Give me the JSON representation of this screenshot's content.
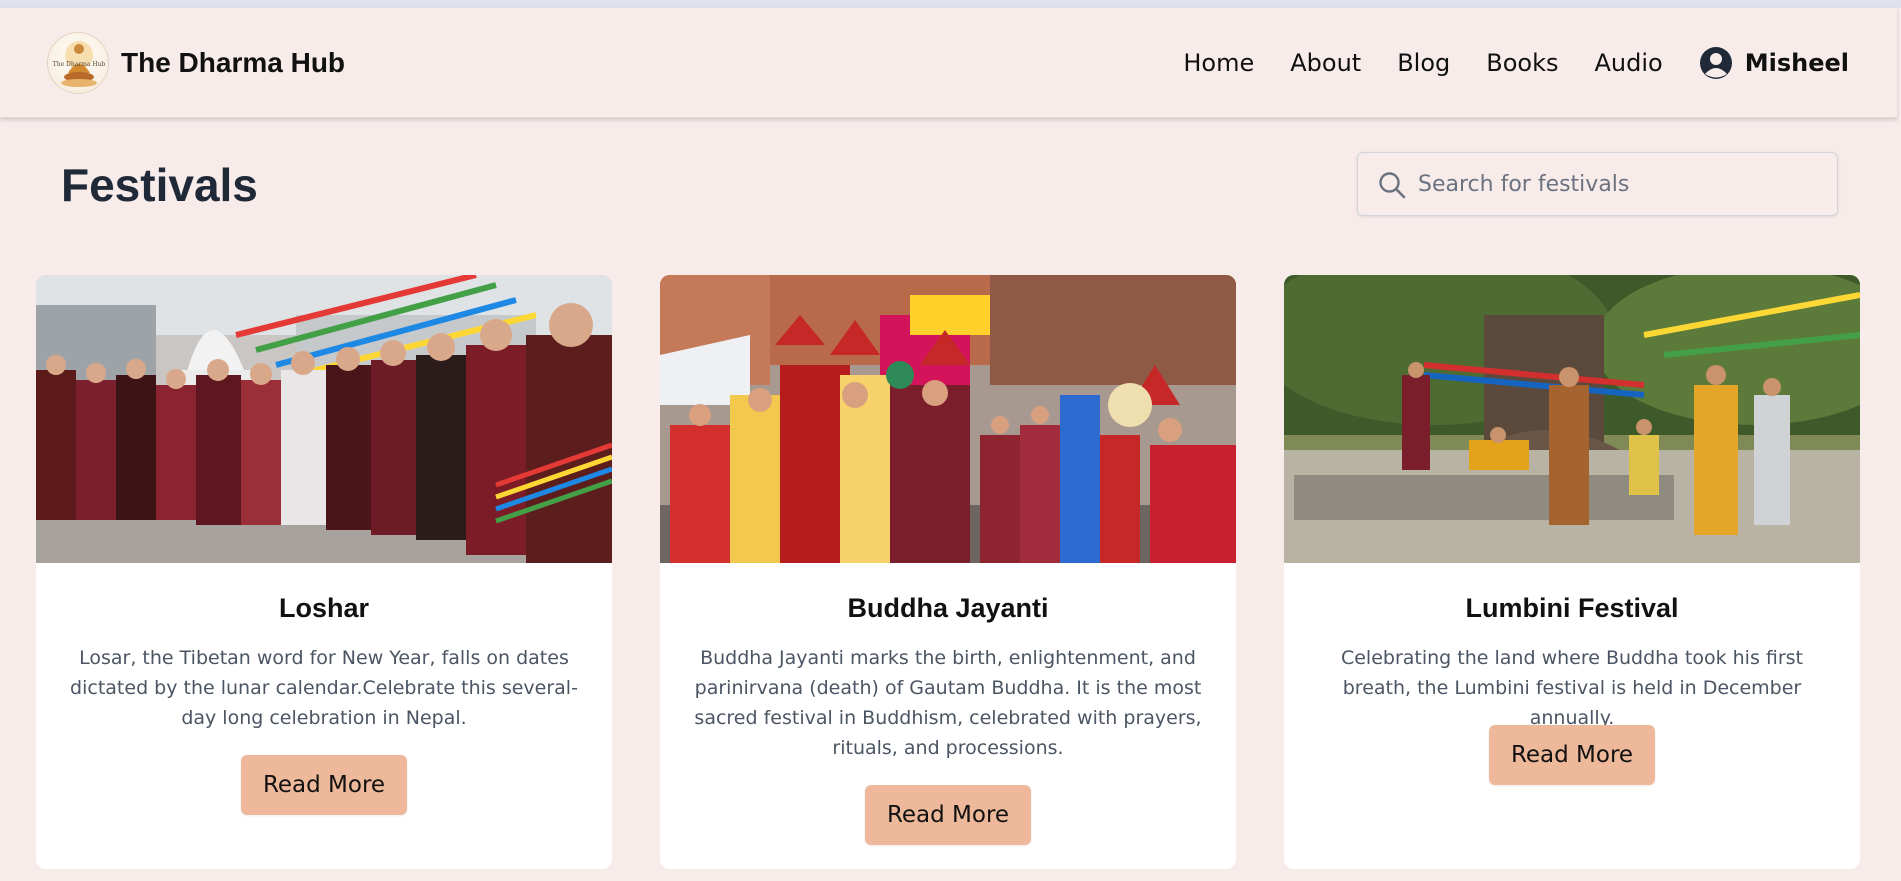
{
  "header": {
    "brand_name": "The Dharma Hub",
    "logo_text": "The Dharma Hub",
    "nav": [
      "Home",
      "About",
      "Blog",
      "Books",
      "Audio"
    ],
    "user_name": "Misheel"
  },
  "page": {
    "title": "Festivals",
    "search_placeholder": "Search for festivals"
  },
  "cards": [
    {
      "title": "Loshar",
      "description": "Losar, the Tibetan word for New Year, falls on dates dictated by the lunar calendar.Celebrate this several-day long celebration in Nepal.",
      "button": "Read More"
    },
    {
      "title": "Buddha Jayanti",
      "description": "Buddha Jayanti marks the birth, enlightenment, and parinirvana (death) of Gautam Buddha. It is the most sacred festival in Buddhism, celebrated with prayers, rituals, and processions.",
      "button": "Read More"
    },
    {
      "title": "Lumbini Festival",
      "description": "Celebrating the land where Buddha took his first breath, the Lumbini festival is held in December annually.",
      "button": "Read More"
    }
  ],
  "colors": {
    "page_background": "#f8eceb",
    "button_background": "#eeb99a",
    "card_background": "#ffffff",
    "title_color": "#1f2937"
  },
  "icons": {
    "search": "search-icon",
    "user": "user-circle-icon",
    "logo": "buddha-logo-icon"
  }
}
